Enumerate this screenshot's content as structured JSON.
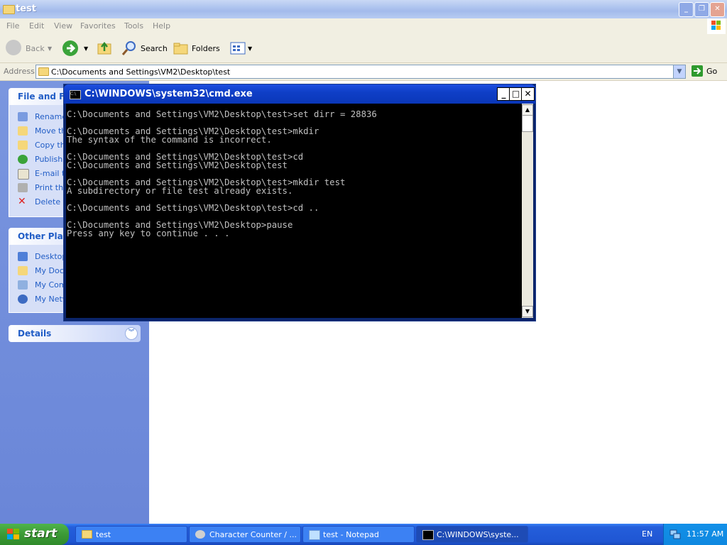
{
  "explorer": {
    "title": "test",
    "menu": [
      "File",
      "Edit",
      "View",
      "Favorites",
      "Tools",
      "Help"
    ],
    "toolbar": {
      "back": "Back",
      "search": "Search",
      "folders": "Folders"
    },
    "address": {
      "label": "Address",
      "value": "C:\\Documents and Settings\\VM2\\Desktop\\test",
      "go": "Go"
    },
    "tasks": {
      "file_header": "File and Fol",
      "file_items": [
        "Rename",
        "Move th",
        "Copy thi",
        "Publish t",
        "E-mail th",
        "Print this",
        "Delete th"
      ],
      "places_header": "Other Place",
      "places_items": [
        "Desktop",
        "My Docu",
        "My Comp",
        "My Netw"
      ],
      "details_header": "Details"
    }
  },
  "cmd": {
    "title": "C:\\WINDOWS\\system32\\cmd.exe",
    "output": "C:\\Documents and Settings\\VM2\\Desktop\\test>set dirr = 28836\n\nC:\\Documents and Settings\\VM2\\Desktop\\test>mkdir\nThe syntax of the command is incorrect.\n\nC:\\Documents and Settings\\VM2\\Desktop\\test>cd\nC:\\Documents and Settings\\VM2\\Desktop\\test\n\nC:\\Documents and Settings\\VM2\\Desktop\\test>mkdir test\nA subdirectory or file test already exists.\n\nC:\\Documents and Settings\\VM2\\Desktop\\test>cd ..\n\nC:\\Documents and Settings\\VM2\\Desktop>pause\nPress any key to continue . . ."
  },
  "taskbar": {
    "start": "start",
    "tasks": [
      "test",
      "Character Counter / ...",
      "test - Notepad",
      "C:\\WINDOWS\\syste..."
    ],
    "language": "EN",
    "clock": "11:57 AM"
  },
  "colors": {
    "xp_blue": "#0a37b8",
    "taskpane": "#6a86d8",
    "start_green": "#3c9a36",
    "console_text": "#c0c0c0"
  }
}
